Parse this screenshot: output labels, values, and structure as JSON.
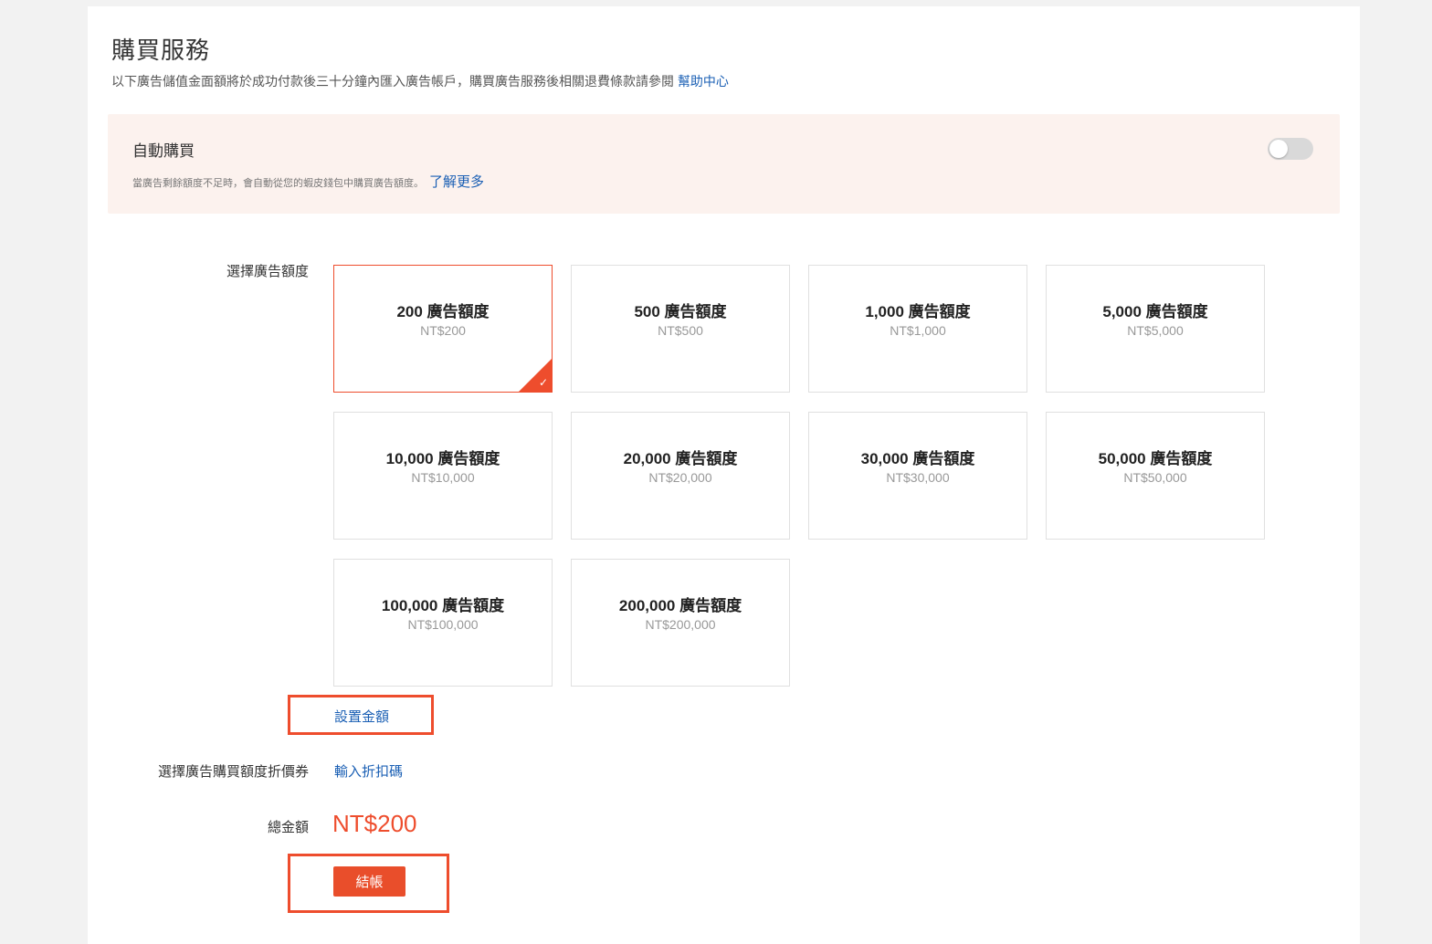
{
  "header": {
    "title": "購買服務",
    "subtitle": "以下廣告儲值金面額將於成功付款後三十分鐘內匯入廣告帳戶，購買廣告服務後相關退費條款請參閱",
    "help_link": "幫助中心"
  },
  "auto_purchase": {
    "title": "自動購買",
    "description": "當廣告剩餘額度不足時，會自動從您的蝦皮錢包中購買廣告額度。",
    "learn_more": "了解更多",
    "toggle_on": false
  },
  "credit": {
    "label": "選擇廣告額度",
    "selected_index": 0,
    "cards": [
      {
        "title": "200 廣告額度",
        "price": "NT$200"
      },
      {
        "title": "500 廣告額度",
        "price": "NT$500"
      },
      {
        "title": "1,000 廣告額度",
        "price": "NT$1,000"
      },
      {
        "title": "5,000 廣告額度",
        "price": "NT$5,000"
      },
      {
        "title": "10,000 廣告額度",
        "price": "NT$10,000"
      },
      {
        "title": "20,000 廣告額度",
        "price": "NT$20,000"
      },
      {
        "title": "30,000 廣告額度",
        "price": "NT$30,000"
      },
      {
        "title": "50,000 廣告額度",
        "price": "NT$50,000"
      },
      {
        "title": "100,000 廣告額度",
        "price": "NT$100,000"
      },
      {
        "title": "200,000 廣告額度",
        "price": "NT$200,000"
      }
    ],
    "custom_amount": "設置金額"
  },
  "coupon": {
    "label": "選擇廣告購買額度折價券",
    "link": "輸入折扣碼"
  },
  "total": {
    "label": "總金額",
    "value": "NT$200"
  },
  "checkout": {
    "label": "結帳"
  },
  "colors": {
    "accent": "#ee4d2d",
    "link": "#1a5fb4",
    "auto_box_bg": "#fcf2ee"
  }
}
